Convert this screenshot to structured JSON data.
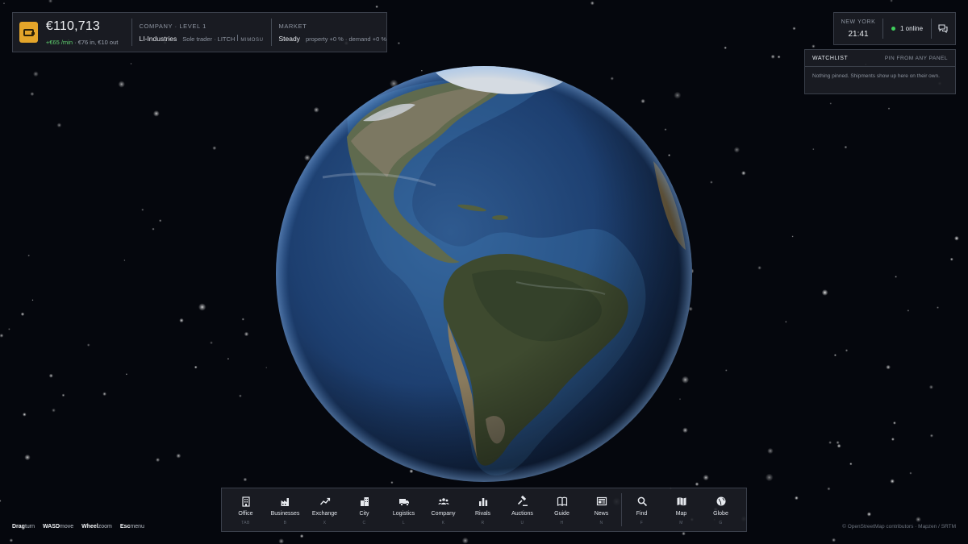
{
  "stats": {
    "balance": "€110,713",
    "rate": "+€65 /min",
    "flow": "· €76 in, €10 out",
    "company_label": "COMPANY · LEVEL 1",
    "company_name": "LI-Industries",
    "company_type": "Sole trader · LITCH",
    "company_tag": "MIMOSU",
    "market_label": "MARKET",
    "market_state": "Steady",
    "market_detail": "property +0 % · demand +0 %"
  },
  "clock": {
    "city": "NEW YORK",
    "time": "21:41",
    "online": "1 online"
  },
  "watchlist": {
    "title": "WATCHLIST",
    "pin_label": "PIN FROM ANY PANEL",
    "empty_text": "Nothing pinned. Shipments show up here on their own."
  },
  "toolbar": {
    "items": [
      {
        "label": "Office",
        "key": "TAB",
        "icon": "office-building-icon"
      },
      {
        "label": "Businesses",
        "key": "B",
        "icon": "factory-icon"
      },
      {
        "label": "Exchange",
        "key": "X",
        "icon": "trend-line-icon"
      },
      {
        "label": "City",
        "key": "C",
        "icon": "city-icon"
      },
      {
        "label": "Logistics",
        "key": "L",
        "icon": "truck-icon"
      },
      {
        "label": "Company",
        "key": "K",
        "icon": "people-icon"
      },
      {
        "label": "Rivals",
        "key": "R",
        "icon": "bar-chart-icon"
      },
      {
        "label": "Auctions",
        "key": "U",
        "icon": "gavel-icon"
      },
      {
        "label": "Guide",
        "key": "H",
        "icon": "book-icon"
      },
      {
        "label": "News",
        "key": "N",
        "icon": "newspaper-icon"
      },
      {
        "label": "Find",
        "key": "F",
        "icon": "search-icon"
      },
      {
        "label": "Map",
        "key": "M",
        "icon": "map-icon"
      },
      {
        "label": "Globe",
        "key": "G",
        "icon": "globe-icon"
      }
    ]
  },
  "hints": [
    {
      "key": "Drag",
      "action": "turn"
    },
    {
      "key": "WASD",
      "action": "move"
    },
    {
      "key": "Wheel",
      "action": "zoom"
    },
    {
      "key": "Esc",
      "action": "menu"
    }
  ],
  "credits": "© OpenStreetMap contributors · Mapzen / SRTM",
  "colors": {
    "accent": "#e4a52a",
    "positive": "#5fcf6e",
    "online": "#3fcf5c",
    "panel": "#1c1f26"
  }
}
